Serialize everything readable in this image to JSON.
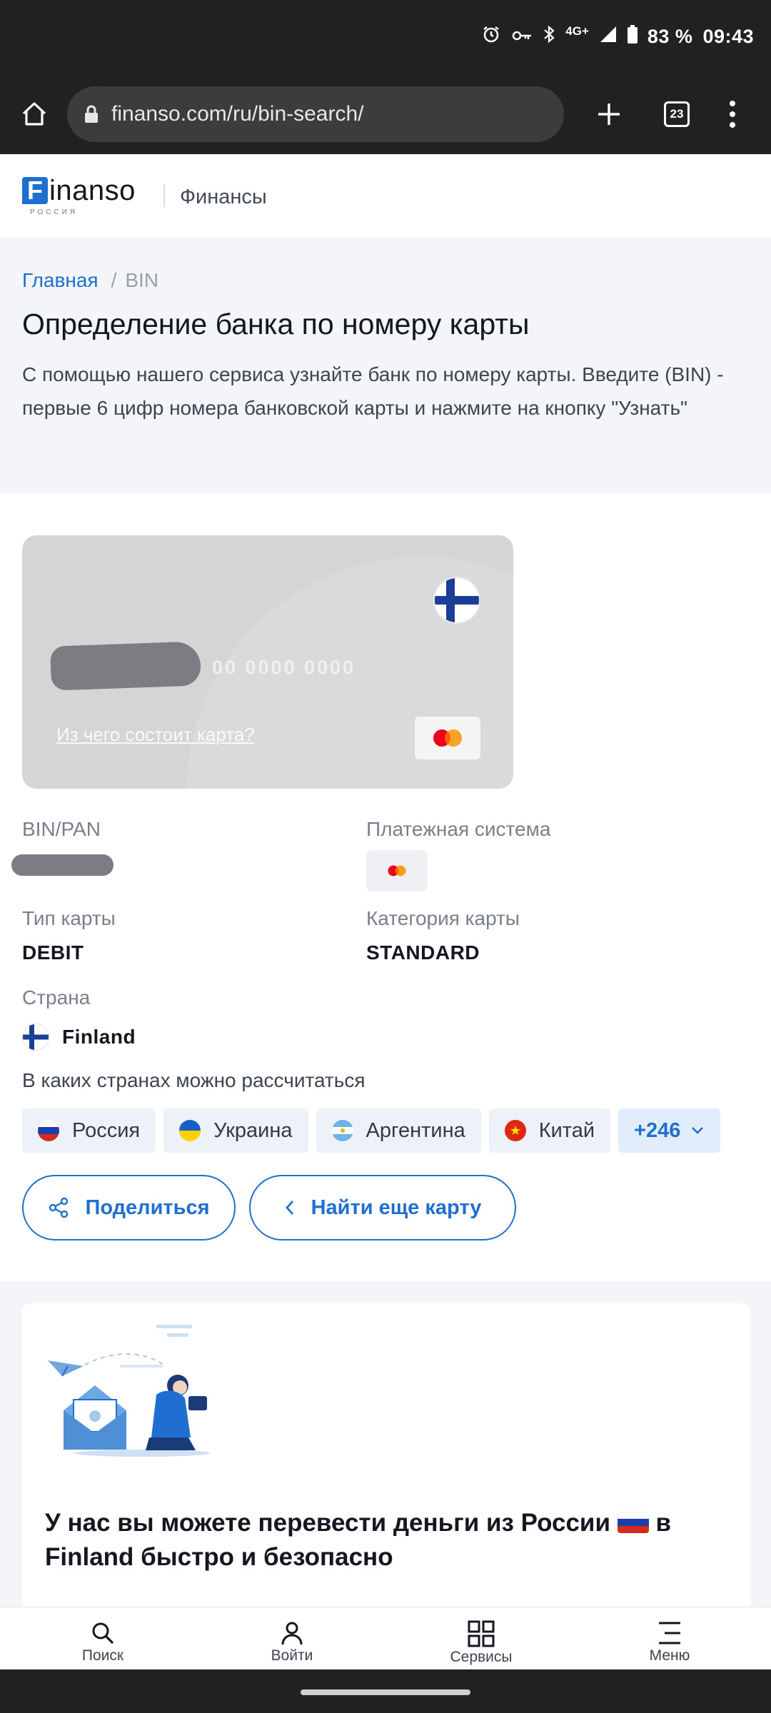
{
  "status_bar": {
    "network": "4G+",
    "battery": "83 %",
    "time": "09:43"
  },
  "browser": {
    "url": "finanso.com/ru/bin-search/",
    "tab_count": "23"
  },
  "header": {
    "logo_f": "F",
    "logo_rest": "inanso",
    "logo_sub": "РОССИЯ",
    "section": "Финансы"
  },
  "breadcrumb": {
    "home": "Главная",
    "separator": "/",
    "current": "BIN"
  },
  "page": {
    "title": "Определение банка по номеру карты",
    "description": "С помощью нашего сервиса узнайте банк по номеру карты. Введите (BIN) - первые 6 цифр номера банковской карты и нажмите на кнопку \"Узнать\""
  },
  "card": {
    "number_tail": "00   0000   0000",
    "link": "Из чего состоит карта?"
  },
  "info": {
    "bin_label": "BIN/PAN",
    "payment_system_label": "Платежная система",
    "card_type_label": "Тип карты",
    "card_type": "DEBIT",
    "card_category_label": "Категория карты",
    "card_category": "STANDARD",
    "country_label": "Страна",
    "country": "Finland",
    "countries_label": "В каких странах можно рассчитаться"
  },
  "chips": [
    {
      "label": "Россия",
      "flag": "russia"
    },
    {
      "label": "Украина",
      "flag": "ukraine"
    },
    {
      "label": "Аргентина",
      "flag": "argentina"
    },
    {
      "label": "Китай",
      "flag": "china"
    }
  ],
  "chips_more": "+246",
  "buttons": {
    "share": "Поделиться",
    "find_another": "Найти еще карту"
  },
  "promo": {
    "title_part1": "У нас вы можете перевести деньги из России",
    "title_part2": "в Finland быстро и безопасно"
  },
  "bottom_nav": [
    {
      "label": "Поиск",
      "icon": "search-icon"
    },
    {
      "label": "Войти",
      "icon": "user-icon"
    },
    {
      "label": "Сервисы",
      "icon": "grid-icon"
    },
    {
      "label": "Меню",
      "icon": "menu-icon"
    }
  ],
  "colors": {
    "accent": "#1f6fd0",
    "card_bg": "#d5d5d5",
    "hero_bg": "#f3f5f9",
    "system_bar": "#212121"
  }
}
